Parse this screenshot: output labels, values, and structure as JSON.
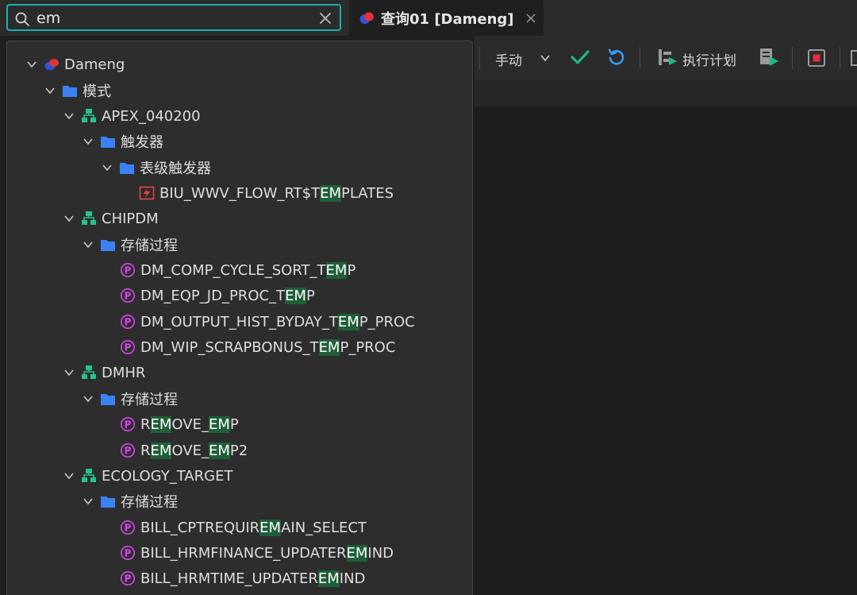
{
  "search": {
    "value": "em",
    "placeholder": ""
  },
  "tab": {
    "title": "查询01 [Dameng]"
  },
  "toolbar": {
    "commit_mode": "手动",
    "plan_label": "执行计划"
  },
  "colors": {
    "accent": "#1bb2ad",
    "highlight": "#1f5f3a",
    "folder": "#3b82f6",
    "schema": "#27c28a",
    "procedure": "#d946ef",
    "trigger": "#ef4444"
  },
  "tree": {
    "connection": "Dameng",
    "schemas_folder": "模式",
    "schemas": [
      {
        "name": "APEX_040200",
        "folder": "触发器",
        "subfolder": "表级触发器",
        "items": [
          {
            "pre": "BIU_WWV_FLOW_RT$T",
            "hl": "EM",
            "post": "PLATES"
          }
        ]
      },
      {
        "name": "CHIPDM",
        "folder": "存储过程",
        "items": [
          {
            "pre": "DM_COMP_CYCLE_SORT_T",
            "hl": "EM",
            "post": "P"
          },
          {
            "pre": "DM_EQP_JD_PROC_T",
            "hl": "EM",
            "post": "P"
          },
          {
            "pre": "DM_OUTPUT_HIST_BYDAY_T",
            "hl": "EM",
            "post": "P_PROC"
          },
          {
            "pre": "DM_WIP_SCRAPBONUS_T",
            "hl": "EM",
            "post": "P_PROC"
          }
        ]
      },
      {
        "name": "DMHR",
        "folder": "存储过程",
        "items": [
          {
            "pre": "R",
            "hl": "EM",
            "mid": "OVE_",
            "hl2": "EM",
            "post": "P"
          },
          {
            "pre": "R",
            "hl": "EM",
            "mid": "OVE_",
            "hl2": "EM",
            "post": "P2"
          }
        ]
      },
      {
        "name": "ECOLOGY_TARGET",
        "folder": "存储过程",
        "items": [
          {
            "pre": "BILL_CPTREQUIR",
            "hl": "EM",
            "post": "AIN_SELECT"
          },
          {
            "pre": "BILL_HRMFINANCE_UPDATER",
            "hl": "EM",
            "post": "IND"
          },
          {
            "pre": "BILL_HRMTIME_UPDATER",
            "hl": "EM",
            "post": "IND"
          }
        ]
      }
    ]
  }
}
